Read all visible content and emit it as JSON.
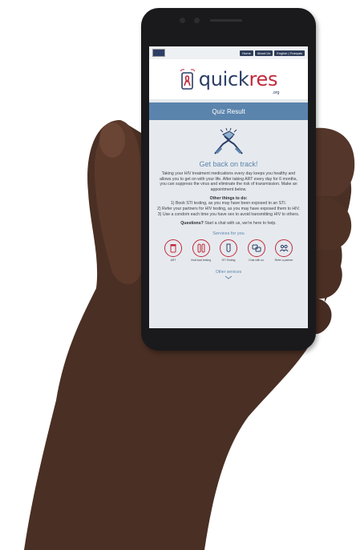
{
  "topbar": {
    "nav": [
      "Home",
      "About Us",
      "English | Français"
    ]
  },
  "logo": {
    "word_a": "quick",
    "word_b": "res",
    "suffix": ".org"
  },
  "banner": {
    "title": "Quiz Result"
  },
  "result": {
    "heading": "Get back on track!",
    "paragraph": "Taking your HIV treatment medications every day keeps you healthy and allows you to get on with your life. After taking ART every day for 6 months, you can suppress the virus and eliminate the risk of transmission. Make an appointment below.",
    "other_title": "Other things to do:",
    "other_items": [
      "1) Book STI testing, as you may have been exposed to an STI.",
      "2) Refer your partners for HIV testing, as you may have exposed them to HIV.",
      "3) Use a condom each time you have sex to avoid transmitting HIV to others."
    ],
    "question_bold": "Questions?",
    "question_rest": " Start a chat with us, we're here to help."
  },
  "services": {
    "title": "Services for you",
    "items": [
      {
        "label": "ART",
        "icon": "pill-bottle-icon"
      },
      {
        "label": "Viral load testing",
        "icon": "test-tubes-icon"
      },
      {
        "label": "STI Testing",
        "icon": "test-vial-icon"
      },
      {
        "label": "Chat with us",
        "icon": "chat-bubbles-icon"
      },
      {
        "label": "Refer a partner",
        "icon": "people-icon"
      }
    ]
  },
  "other_services": {
    "label": "Other services"
  },
  "colors": {
    "navy": "#2c3e66",
    "accent_red": "#c22a3a",
    "banner_blue": "#5b84ad"
  }
}
